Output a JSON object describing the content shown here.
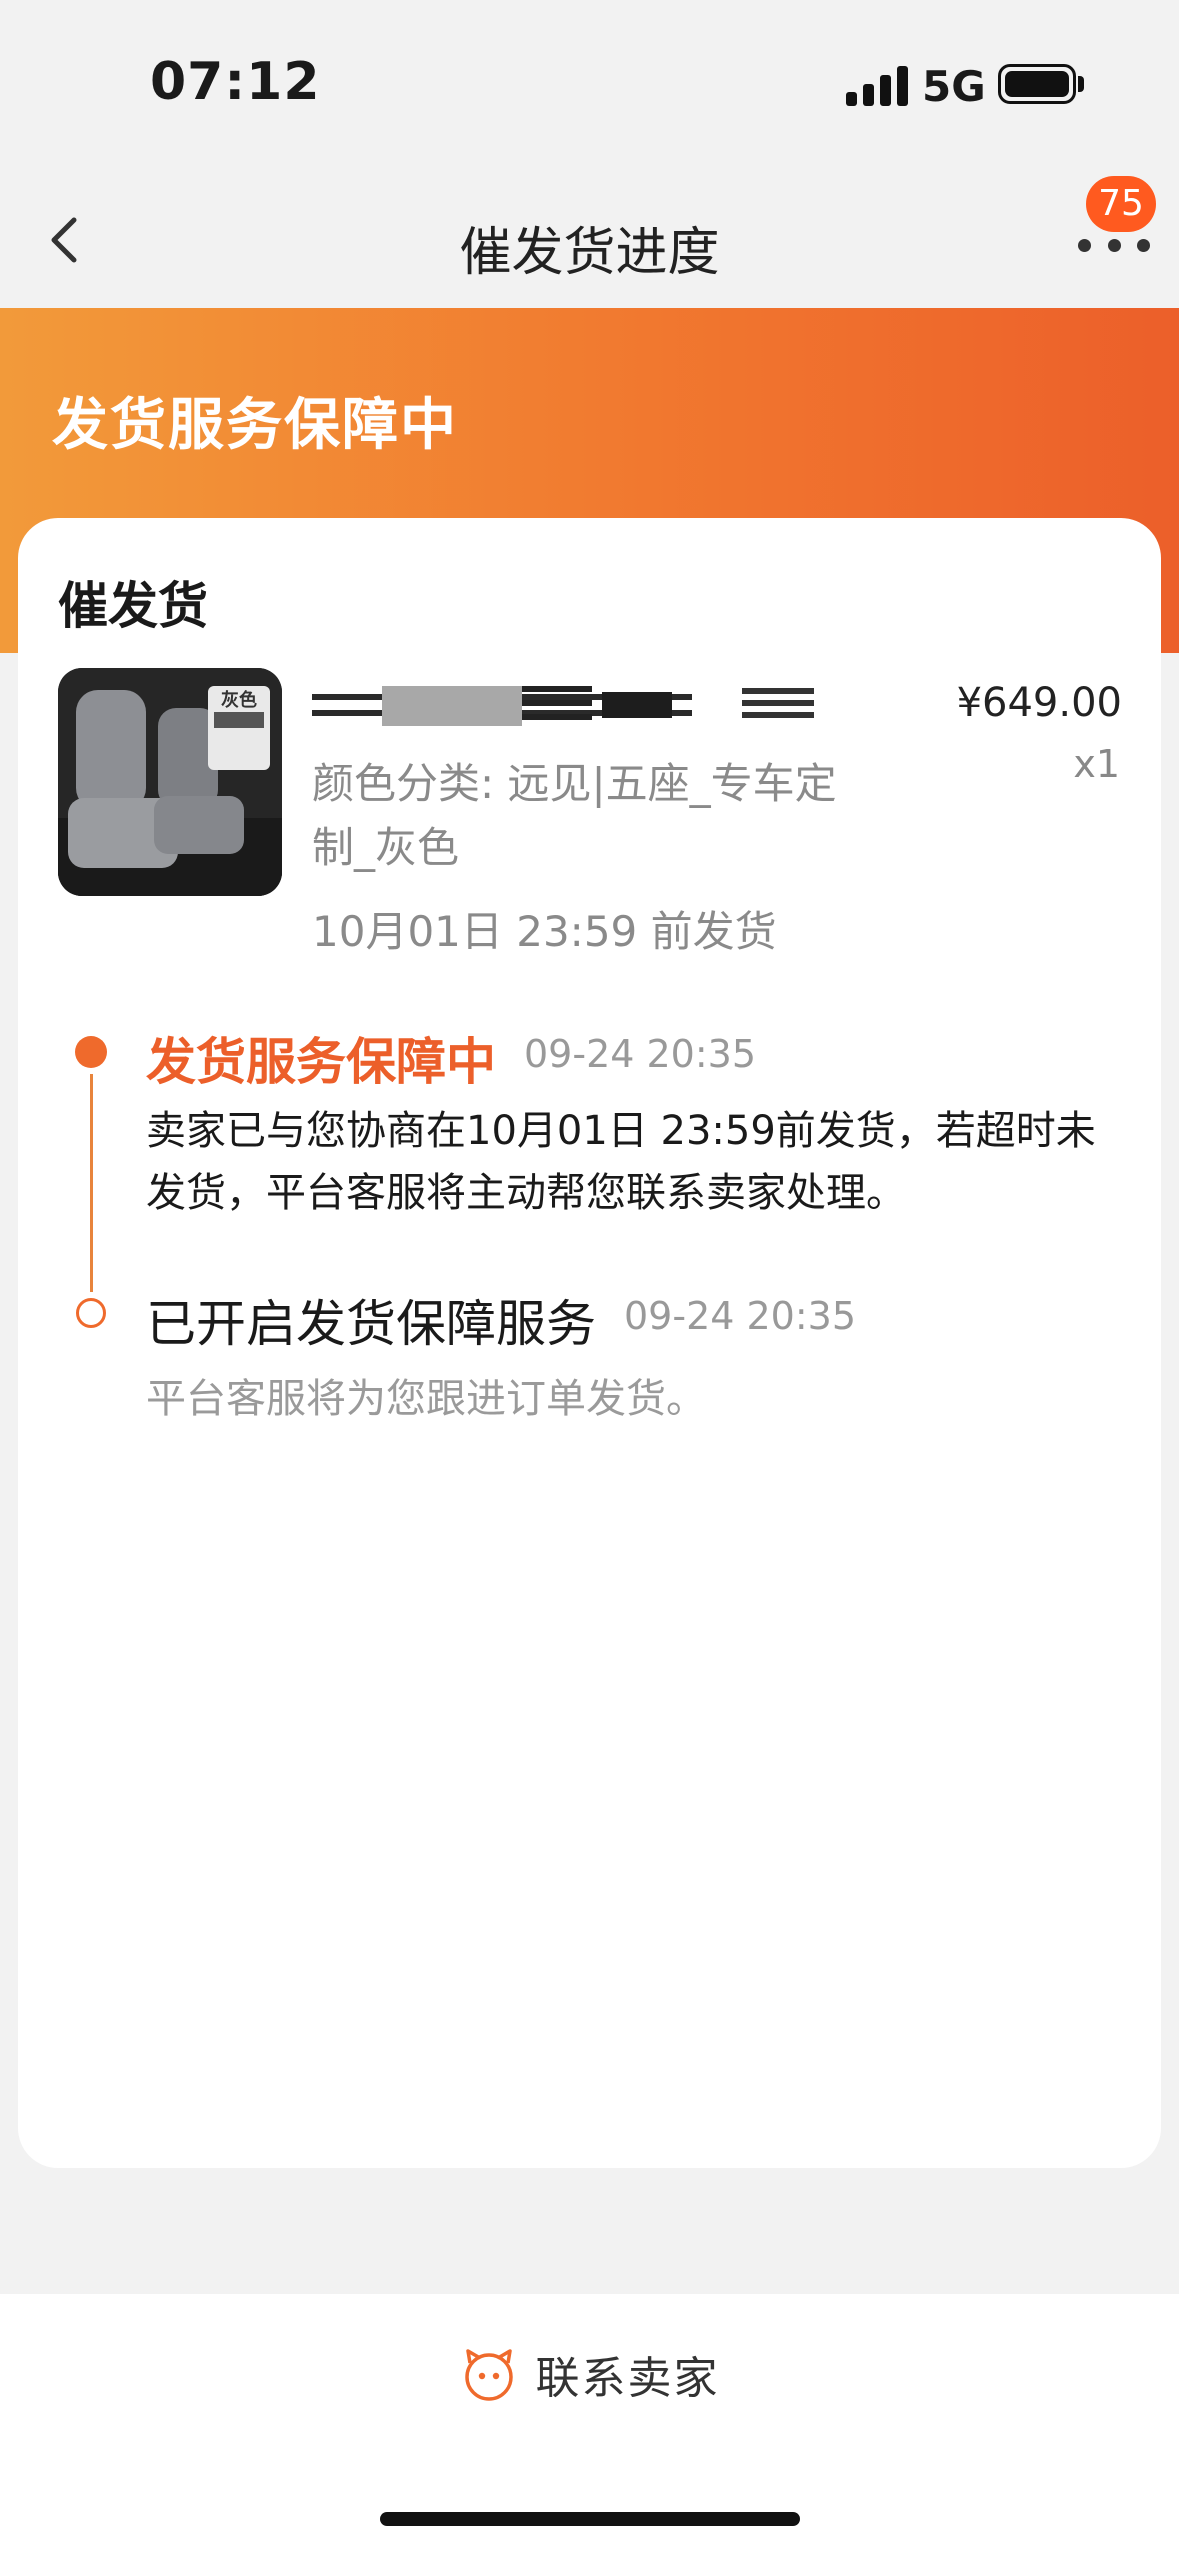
{
  "status_bar": {
    "time": "07:12",
    "network": "5G"
  },
  "nav": {
    "title": "催发货进度",
    "badge_count": "75"
  },
  "banner": {
    "title": "发货服务保障中"
  },
  "card": {
    "title": "催发货",
    "product": {
      "price": "¥649.00",
      "quantity": "x1",
      "spec": "颜色分类: 远见|五座_专车定制_灰色",
      "deadline": "10月01日 23:59 前发货",
      "thumb_label": "灰色"
    }
  },
  "timeline": [
    {
      "title": "发货服务保障中",
      "time": "09-24 20:35",
      "desc": "卖家已与您协商在10月01日 23:59前发货，若超时未发货，平台客服将主动帮您联系卖家处理。"
    },
    {
      "title": "已开启发货保障服务",
      "time": "09-24 20:35",
      "desc": "平台客服将为您跟进订单发货。"
    }
  ],
  "bottom": {
    "contact_label": "联系卖家"
  },
  "colors": {
    "accent": "#ec5f2a",
    "banner_start": "#f29a3a",
    "banner_end": "#ec5f2a"
  }
}
